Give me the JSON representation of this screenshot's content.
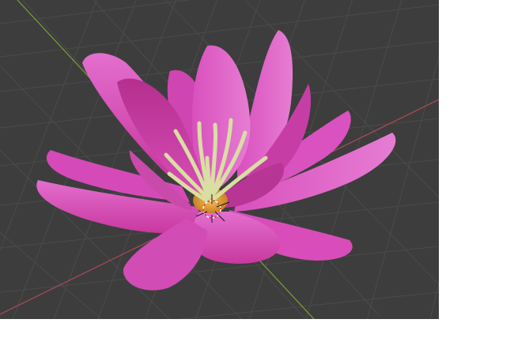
{
  "viewport": {
    "background_color": "#3d3d3d",
    "grid_line_color": "#4a4a4a",
    "x_axis_color": "#b04a57",
    "y_axis_color": "#7aa13a",
    "object": "flower",
    "petal_color": "#d94fbf",
    "stamen_color": "#dbe0a6",
    "center_color": "#e0a03a"
  },
  "page_margin_color": "#ffffff"
}
